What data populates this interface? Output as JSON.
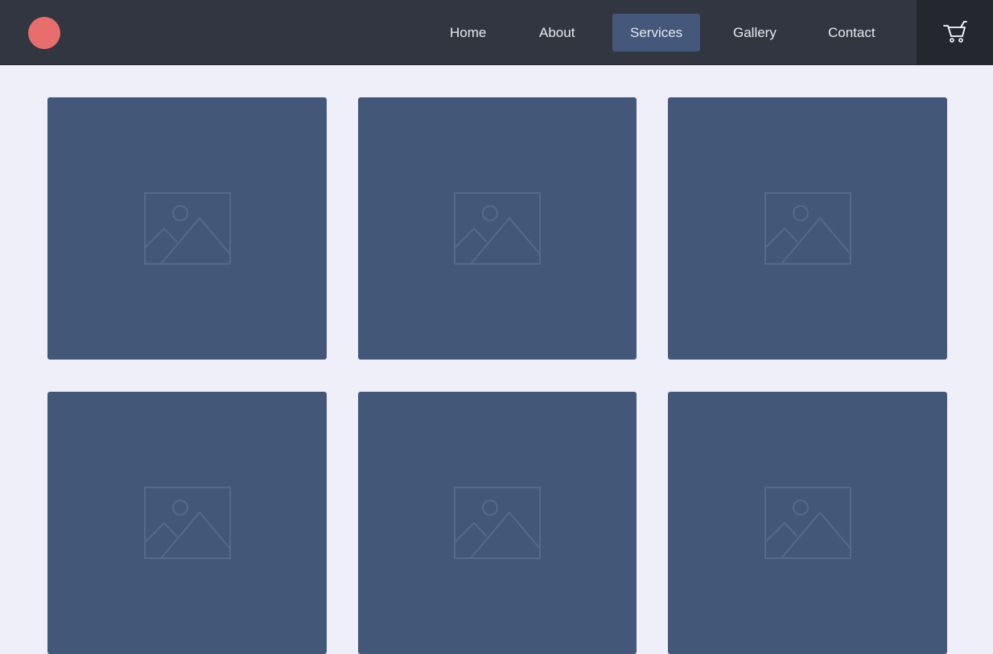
{
  "nav": {
    "items": [
      {
        "label": "Home",
        "active": false
      },
      {
        "label": "About",
        "active": false
      },
      {
        "label": "Services",
        "active": true
      },
      {
        "label": "Gallery",
        "active": false
      },
      {
        "label": "Contact",
        "active": false
      }
    ],
    "cart_icon": "cart-icon",
    "logo_color": "#e86d6d"
  },
  "colors": {
    "header_bg": "#323640",
    "active_nav": "#43587a",
    "card_bg": "#435879",
    "page_bg": "#eeeff8"
  },
  "gallery": {
    "card_count": 6,
    "placeholder_icon": "image-placeholder-icon"
  }
}
